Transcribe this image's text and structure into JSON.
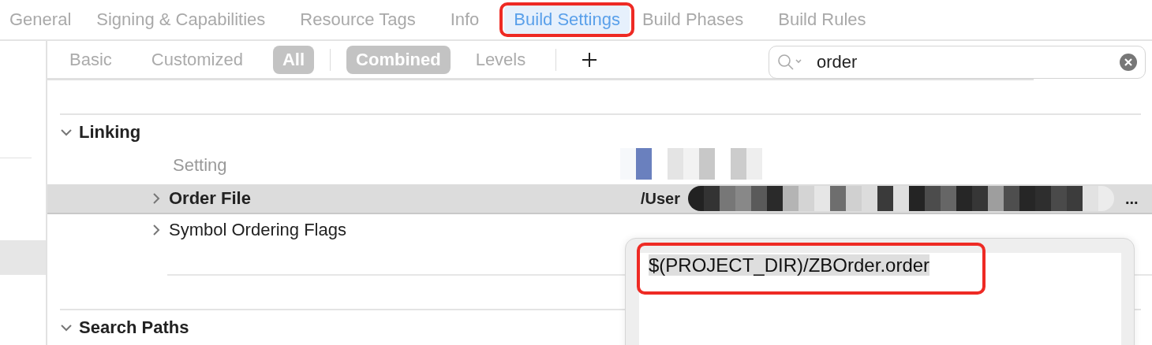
{
  "tabs": [
    {
      "label": "General",
      "selected": false
    },
    {
      "label": "Signing & Capabilities",
      "selected": false
    },
    {
      "label": "Resource Tags",
      "selected": false
    },
    {
      "label": "Info",
      "selected": false
    },
    {
      "label": "Build Settings",
      "selected": true,
      "annotated": true
    },
    {
      "label": "Build Phases",
      "selected": false
    },
    {
      "label": "Build Rules",
      "selected": false
    }
  ],
  "sidebar": {
    "items": [
      {
        "selected": false
      },
      {
        "selected": true
      }
    ]
  },
  "filters": [
    {
      "kind": "segment",
      "label": "Basic",
      "selected": false
    },
    {
      "kind": "segment",
      "label": "Customized",
      "selected": false
    },
    {
      "kind": "segment",
      "label": "All",
      "selected": true
    },
    {
      "kind": "divider"
    },
    {
      "kind": "segment",
      "label": "Combined",
      "selected": true
    },
    {
      "kind": "segment",
      "label": "Levels",
      "selected": false
    },
    {
      "kind": "divider"
    },
    {
      "kind": "add"
    }
  ],
  "search": {
    "value": "order"
  },
  "sections": [
    {
      "title": "Linking",
      "expanded": true,
      "column_header": "Setting",
      "rows": [
        {
          "name": "Order File",
          "selected": true,
          "expanded": false,
          "value": "/User",
          "value_end": "..."
        },
        {
          "name": "Symbol Ordering Flags",
          "selected": false,
          "expanded": false
        }
      ]
    },
    {
      "title": "Search Paths",
      "expanded": true
    }
  ],
  "editor_popup": {
    "value": "$(PROJECT_DIR)/ZBOrder.order",
    "annotated": true
  }
}
